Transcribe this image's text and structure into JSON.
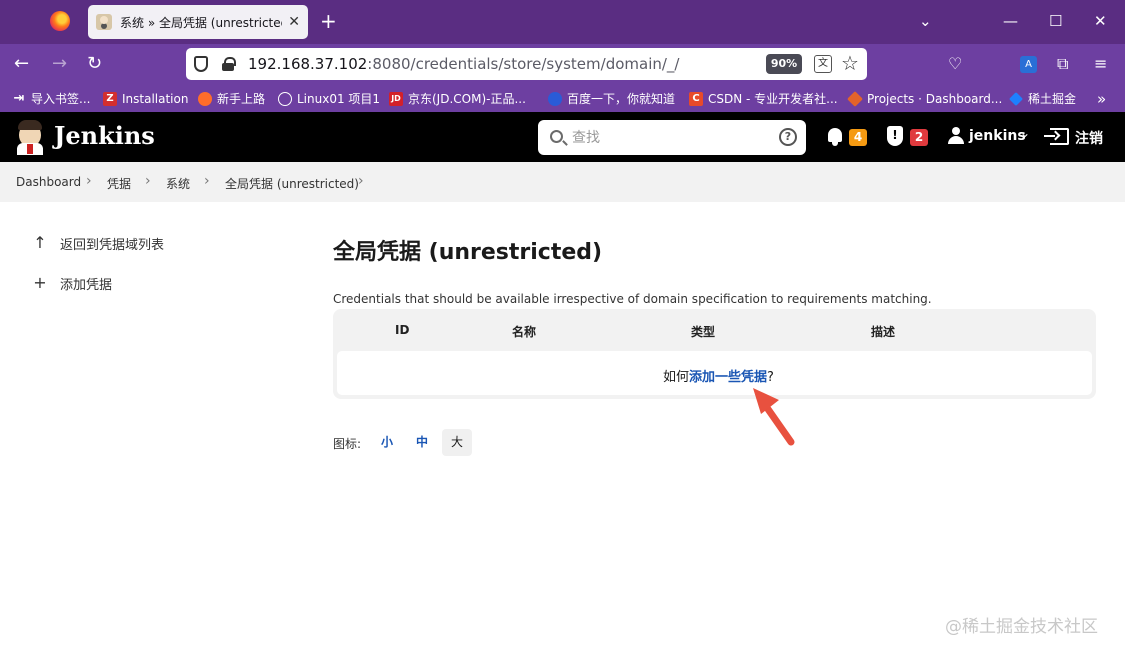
{
  "browser": {
    "tab_title": "系统 » 全局凭据 (unrestricted)",
    "tab_close": "✕",
    "new_tab": "+",
    "url_host": "192.168.37.102",
    "url_rest": ":8080/credentials/store/system/domain/_/",
    "zoom": "90%",
    "bookmarks": [
      {
        "label": "导入书签...",
        "icon": "import-icon",
        "color": "#6d3fa1"
      },
      {
        "label": "Installation",
        "icon": "Z",
        "color": "#d32f2f"
      },
      {
        "label": "新手上路",
        "icon": "firefox-icon",
        "color": "#ff6d2a"
      },
      {
        "label": "Linux01 项目1",
        "icon": "globe-icon",
        "color": "#6d3fa1"
      },
      {
        "label": "京东(JD.COM)-正品...",
        "icon": "JD",
        "color": "#d3202a"
      },
      {
        "label": "百度一下，你就知道",
        "icon": "paw-icon",
        "color": "#2a5bd7"
      },
      {
        "label": "CSDN - 专业开发者社...",
        "icon": "C",
        "color": "#e84a2a"
      },
      {
        "label": "Projects · Dashboard...",
        "icon": "gitlab-icon",
        "color": "#e2632a"
      },
      {
        "label": "稀土掘金",
        "icon": "juejin-icon",
        "color": "#1e80ff"
      }
    ]
  },
  "jenkins": {
    "name": "Jenkins",
    "search_placeholder": "查找",
    "help": "?",
    "notifications_count": "4",
    "security_count": "2",
    "security_mark": "!",
    "user": "jenkins",
    "logout": "注销"
  },
  "breadcrumb": [
    "Dashboard",
    "凭据",
    "系统",
    "全局凭据 (unrestricted)"
  ],
  "breadcrumb_sep": "›",
  "sidebar": [
    {
      "label": "返回到凭据域列表",
      "icon": "↑"
    },
    {
      "label": "添加凭据",
      "icon": "+"
    }
  ],
  "main": {
    "title": "全局凭据 (unrestricted)",
    "description": "Credentials that should be available irrespective of domain specification to requirements matching.",
    "columns": [
      "ID",
      "名称",
      "类型",
      "描述"
    ],
    "empty_prefix": "如何",
    "empty_link": "添加一些凭据",
    "empty_suffix": "?",
    "icon_label": "图标:",
    "icon_sizes": [
      "小",
      "中",
      "大"
    ],
    "active_icon_size": "大"
  },
  "watermark": "@稀土掘金技术社区",
  "colors": {
    "link": "#1a56b4",
    "arrow": "#e8513f",
    "badge_orange": "#f59a12",
    "badge_red": "#e03a3e"
  }
}
